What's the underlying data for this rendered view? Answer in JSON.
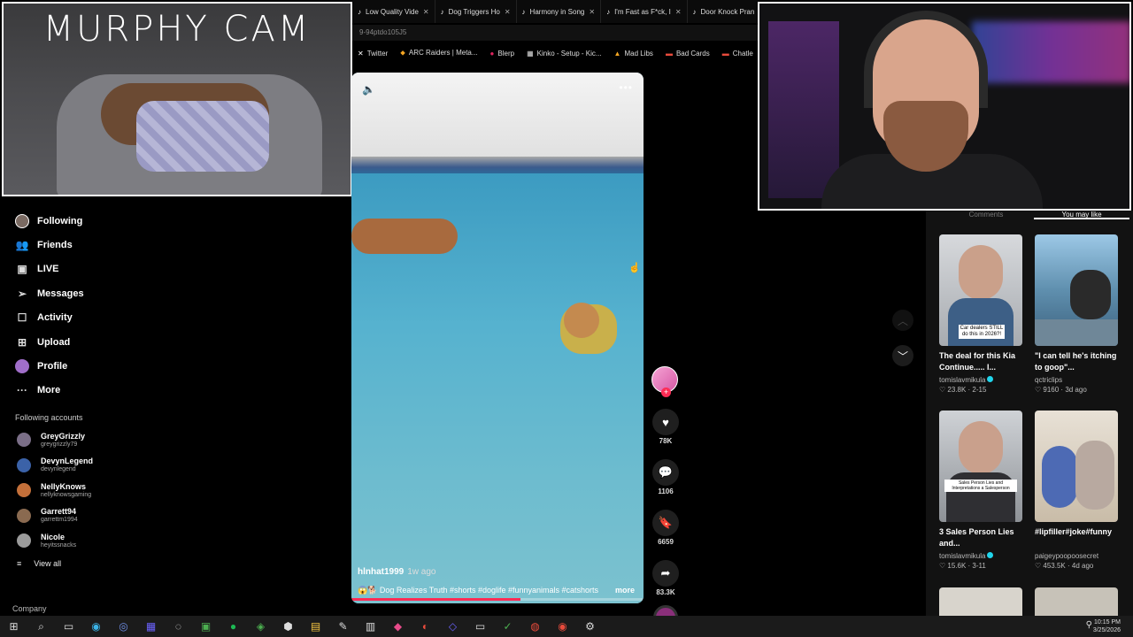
{
  "browser": {
    "tabs": [
      {
        "label": "Low Quality Vide"
      },
      {
        "label": "Dog Triggers Ho"
      },
      {
        "label": "Harmony in Song"
      },
      {
        "label": "I'm Fast as F*ck, I"
      },
      {
        "label": "Door Knock Pran"
      }
    ],
    "url": "9-94ptdo105J5",
    "bookmarks": [
      "Twitter",
      "ARC Raiders | Meta...",
      "Blerp",
      "Kinko - Setup - Kic...",
      "Mad Libs",
      "Bad Cards",
      "Chatle"
    ]
  },
  "overlay": {
    "murphy_title": "MURPHY CAM"
  },
  "sidebar": {
    "nav": [
      {
        "label": "Following",
        "icon": "avatar-icon"
      },
      {
        "label": "Friends",
        "icon": "friends-icon"
      },
      {
        "label": "LIVE",
        "icon": "live-icon"
      },
      {
        "label": "Messages",
        "icon": "messages-icon"
      },
      {
        "label": "Activity",
        "icon": "activity-icon"
      },
      {
        "label": "Upload",
        "icon": "upload-icon"
      },
      {
        "label": "Profile",
        "icon": "profile-icon"
      },
      {
        "label": "More",
        "icon": "more-icon"
      }
    ],
    "following_heading": "Following accounts",
    "accounts": [
      {
        "name": "GreyGrizzly",
        "handle": "greygrizzly79",
        "color": "#7b6f88"
      },
      {
        "name": "DevynLegend",
        "handle": "devynlegend",
        "color": "#3b62a8"
      },
      {
        "name": "NellyKnows",
        "handle": "nellyknowsgaming",
        "color": "#c4703a"
      },
      {
        "name": "Garrett94",
        "handle": "garrettm1994",
        "color": "#8a6a50"
      },
      {
        "name": "Nicole",
        "handle": "heyitssnacks",
        "color": "#9b9b9b"
      }
    ],
    "view_all": "View all",
    "company": "Company"
  },
  "video": {
    "author": "hlnhat1999",
    "posted": "1w ago",
    "caption": "😱🐕 Dog Realizes Truth #shorts #doglife #funnyanimals #catshorts",
    "caption_more": "more",
    "progress": 0.58,
    "likes": "78K",
    "comments": "1106",
    "saves": "6659",
    "shares": "83.3K"
  },
  "right_panel": {
    "tabs": [
      "Comments",
      "You may like"
    ],
    "cards": [
      {
        "title": "The deal for this Kia Continue..... I...",
        "author": "tomislavmikula",
        "verified": true,
        "likes": "23.8K",
        "date": "2-15",
        "thumb_text": "Car dealers STILL do this in 2026?!"
      },
      {
        "title": "\"I can tell he's itching to goop\"...",
        "author": "qctriclips",
        "verified": false,
        "likes": "9160",
        "date": "3d ago",
        "thumb_text": ""
      },
      {
        "title": "3 Sales Person Lies and...",
        "author": "tomislavmikula",
        "verified": true,
        "likes": "15.6K",
        "date": "3-11",
        "thumb_text": "Sales Person Lies and Interpretations a Salesperson"
      },
      {
        "title": "#lipfiller#joke#funny",
        "author": "paigeypoopoosecret",
        "verified": false,
        "likes": "453.5K",
        "date": "4d ago",
        "thumb_text": ""
      }
    ]
  },
  "taskbar": {
    "time": "10:15 PM",
    "date": "3/25/2026"
  },
  "colors": {
    "accent": "#fe2c55",
    "verified": "#20d5ec"
  }
}
